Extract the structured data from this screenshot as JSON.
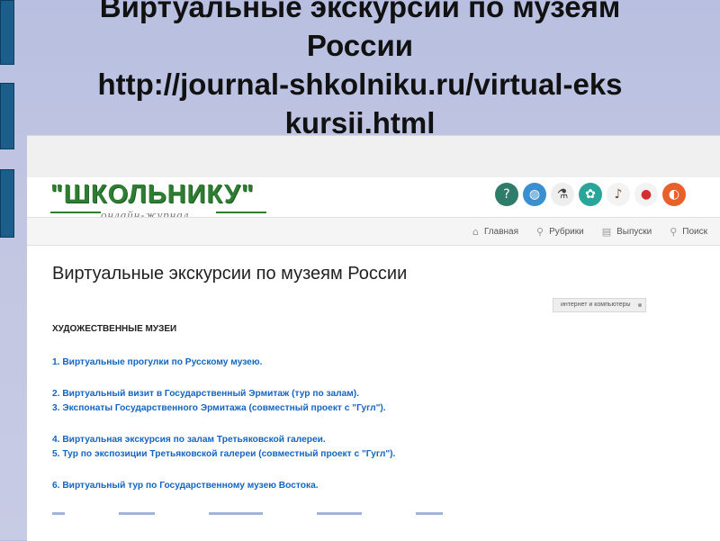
{
  "slide": {
    "title_lines": [
      "Виртуальные экскурсии по музеям",
      "России",
      "http://journal-shkolniku.ru/virtual-eks",
      "kursii.html"
    ],
    "accent_color": "#1b5e8c"
  },
  "site": {
    "logo_text": "\"ШКОЛЬНИКУ\"",
    "logo_subtitle": "онлайн-журнал",
    "logo_color": "#2e7d32",
    "category_icons": [
      "question-icon",
      "globe-icon",
      "microscope-icon",
      "palette-icon",
      "lyre-icon",
      "ladybug-icon",
      "ball-icon"
    ],
    "nav": [
      {
        "label": "Главная",
        "icon": "home-icon"
      },
      {
        "label": "Рубрики",
        "icon": "tags-icon"
      },
      {
        "label": "Выпуски",
        "icon": "folder-icon"
      },
      {
        "label": "Поиск",
        "icon": "search-icon"
      }
    ]
  },
  "article": {
    "title": "Виртуальные экскурсии по музеям России",
    "tag": "интернет и компьютеры",
    "section": "ХУДОЖЕСТВЕННЫЕ МУЗЕИ",
    "links": [
      "1. Виртуальные прогулки по Русскому музею.",
      "2. Виртуальный визит в Государственный Эрмитаж (тур по залам).",
      "3. Экспонаты Государственного Эрмитажа (совместный проект с \"Гугл\").",
      "4. Виртуальная экскурсия по залам Третьяковской галереи.",
      "5. Тур по экспозиции Третьяковской галереи (совместный проект с \"Гугл\").",
      "6. Виртуальный тур по Государственному музею Востока."
    ],
    "link_color": "#1565c0"
  }
}
